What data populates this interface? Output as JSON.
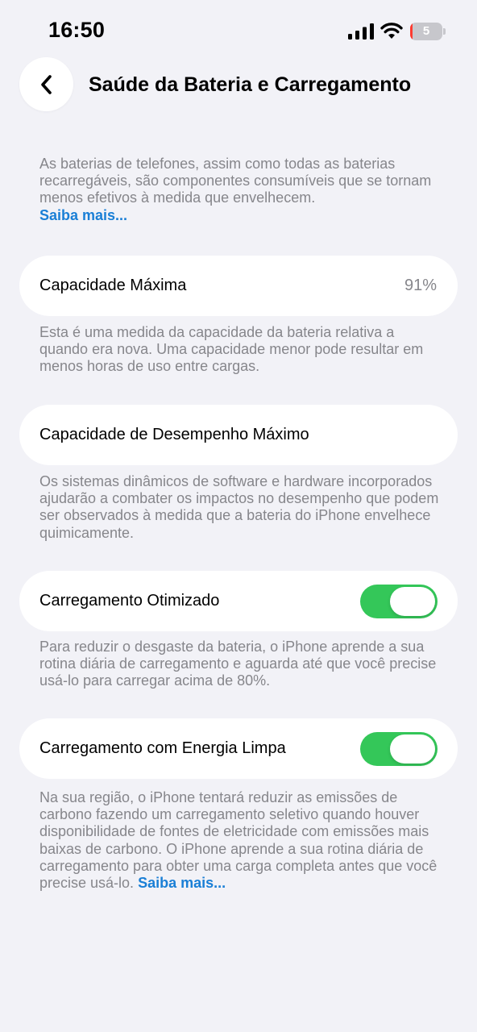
{
  "status_bar": {
    "time": "16:50",
    "battery_level": "5",
    "battery_fraction": 0.05,
    "icons": [
      "cellular-signal-icon",
      "wifi-icon",
      "battery-icon"
    ]
  },
  "header": {
    "back_icon": "chevron-left-icon",
    "title": "Saúde da Bateria e Carregamento"
  },
  "intro": {
    "text": "As baterias de telefones, assim como todas as baterias recarregáveis, são componentes consumíveis que se tornam menos efetivos à medida que envelhecem.",
    "link": "Saiba mais..."
  },
  "sections": {
    "max_capacity": {
      "label": "Capacidade Máxima",
      "value": "91%",
      "footer": "Esta é uma medida da capacidade da bateria relativa a quando era nova. Uma capacidade menor pode resultar em menos horas de uso entre cargas."
    },
    "peak_performance": {
      "label": "Capacidade de Desempenho Máximo",
      "footer": "Os sistemas dinâmicos de software e hardware incorporados ajudarão a combater os impactos no desempenho que podem ser observados à medida que a bateria do iPhone envelhece quimicamente."
    },
    "optimized_charging": {
      "label": "Carregamento Otimizado",
      "enabled": true,
      "footer": "Para reduzir o desgaste da bateria, o iPhone aprende a sua rotina diária de carregamento e aguarda até que você precise usá-lo para carregar acima de 80%."
    },
    "clean_energy": {
      "label": "Carregamento com Energia Limpa",
      "enabled": true,
      "footer": "Na sua região, o iPhone tentará reduzir as emissões de carbono fazendo um carregamento seletivo quando houver disponibilidade de fontes de eletricidade com emissões mais baixas de carbono. O iPhone aprende a sua rotina diária de carregamento para obter uma carga completa antes que você precise usá-lo.",
      "link": "Saiba mais..."
    }
  },
  "colors": {
    "background": "#f2f2f7",
    "toggle_on": "#34c759",
    "link": "#1a7fd6",
    "secondary_text": "#86868b",
    "battery_low": "#ff3b30"
  }
}
